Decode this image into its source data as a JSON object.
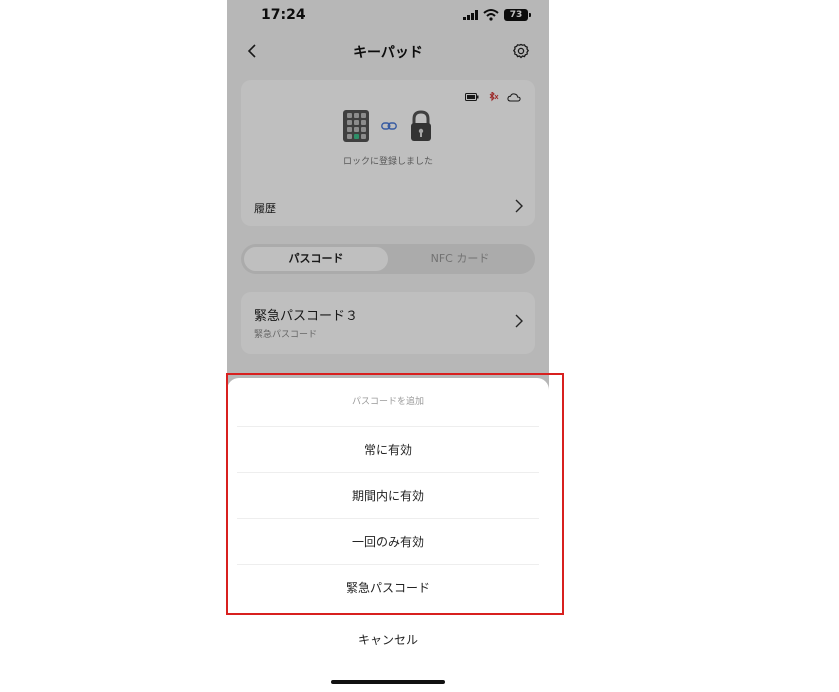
{
  "status_bar": {
    "time": "17:24",
    "battery": "73"
  },
  "nav": {
    "title": "キーパッド"
  },
  "device_card": {
    "status_text": "ロックに登録しました",
    "history_label": "履歴"
  },
  "tabs": {
    "active": "パスコード",
    "inactive": "NFC カード"
  },
  "passcode_item": {
    "title": "緊急パスコード３",
    "subtitle": "緊急パスコード"
  },
  "sheet": {
    "title": "パスコードを追加",
    "options": [
      "常に有効",
      "期間内に有効",
      "一回のみ有効",
      "緊急パスコード"
    ],
    "cancel": "キャンセル"
  },
  "colors": {
    "highlight": "#d8201f",
    "accent_link": "#4a7ad8",
    "keypad_led": "#3fbf8c"
  }
}
